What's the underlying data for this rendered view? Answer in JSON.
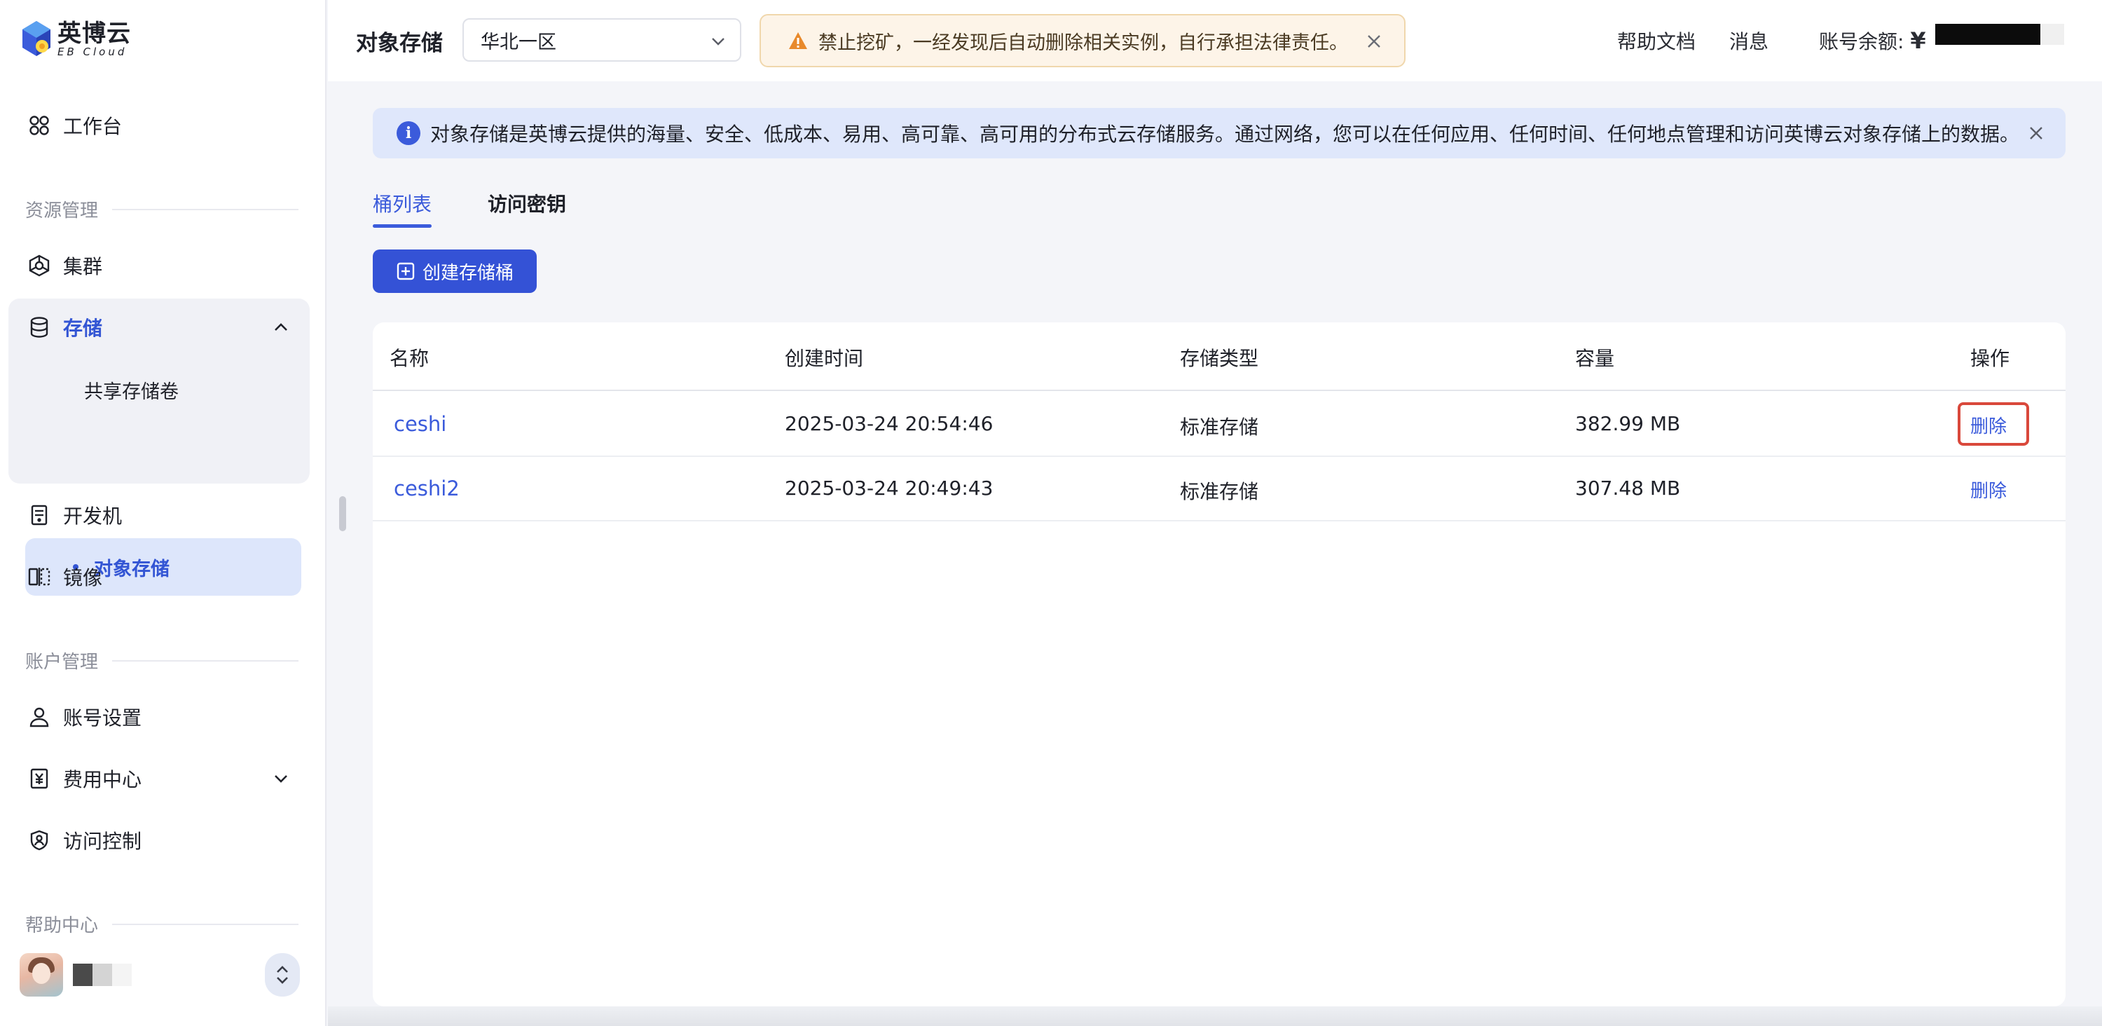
{
  "brand": {
    "name_cn": "英博云",
    "name_en": "EB Cloud"
  },
  "sidebar": {
    "workbench": "工作台",
    "sections": {
      "resource": "资源管理",
      "account": "账户管理",
      "help": "帮助中心"
    },
    "items": {
      "cluster": "集群",
      "storage": "存储",
      "shared_volume": "共享存储卷",
      "object_storage": "对象存储",
      "devbox": "开发机",
      "image": "镜像",
      "account_settings": "账号设置",
      "billing": "费用中心",
      "access_control": "访问控制"
    }
  },
  "topbar": {
    "title": "对象存储",
    "region": "华北一区",
    "warning": "禁止挖矿，一经发现后自动删除相关实例，自行承担法律责任。",
    "help_docs": "帮助文档",
    "messages": "消息",
    "balance_label": "账号余额:",
    "currency": "¥"
  },
  "main": {
    "info": "对象存储是英博云提供的海量、安全、低成本、易用、高可靠、高可用的分布式云存储服务。通过网络，您可以在任何应用、任何时间、任何地点管理和访问英博云对象存储上的数据。",
    "tabs": [
      "桶列表",
      "访问密钥"
    ],
    "create_button": "创建存储桶",
    "table": {
      "headers": [
        "名称",
        "创建时间",
        "存储类型",
        "容量",
        "操作"
      ],
      "rows": [
        {
          "name": "ceshi",
          "created": "2025-03-24 20:54:46",
          "type": "标准存储",
          "size": "382.99 MB",
          "action": "删除"
        },
        {
          "name": "ceshi2",
          "created": "2025-03-24 20:49:43",
          "type": "标准存储",
          "size": "307.48 MB",
          "action": "删除"
        }
      ]
    }
  },
  "colors": {
    "accent": "#3b5bdb",
    "highlight": "#d9483b",
    "warning_bg": "#fdf4e8",
    "info_bg": "#dfe7fb"
  }
}
